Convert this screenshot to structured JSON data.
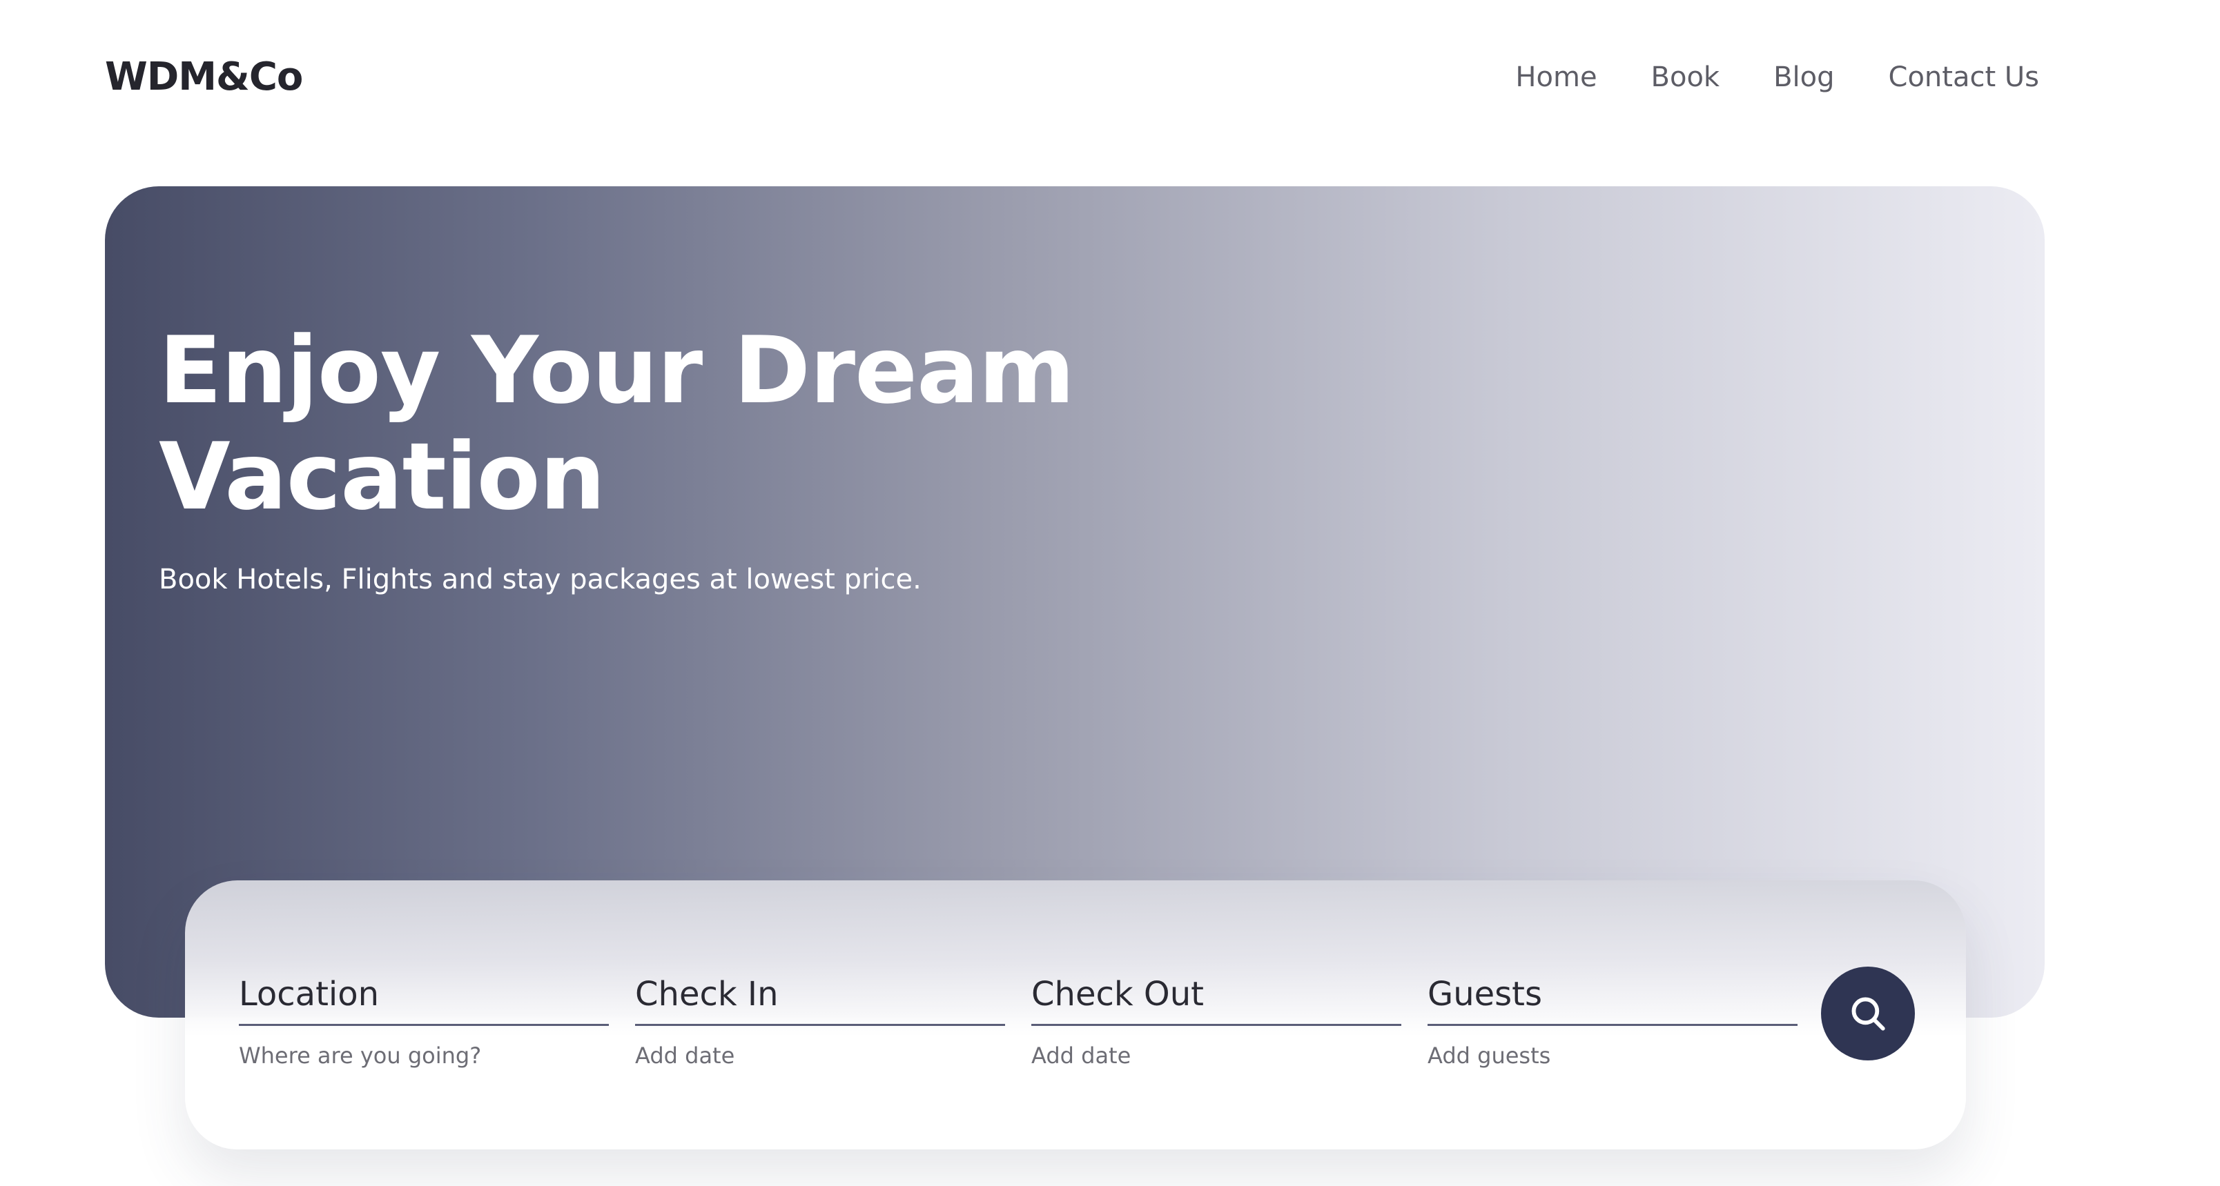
{
  "brand": {
    "logo": "WDM&Co"
  },
  "nav": {
    "items": [
      "Home",
      "Book",
      "Blog",
      "Contact Us"
    ]
  },
  "hero": {
    "title_line1": "Enjoy Your Dream",
    "title_line2": "Vacation",
    "subtitle": "Book Hotels, Flights and stay packages at lowest price."
  },
  "search": {
    "fields": [
      {
        "label": "Location",
        "placeholder": "Where are you going?"
      },
      {
        "label": "Check In",
        "placeholder": "Add date"
      },
      {
        "label": "Check Out",
        "placeholder": "Add date"
      },
      {
        "label": "Guests",
        "placeholder": "Add guests"
      }
    ],
    "button_icon": "search-icon"
  },
  "colors": {
    "accent": "#2f3553",
    "hero_start": "#474c66",
    "hero_end": "#ececf3",
    "text_dark": "#25252d",
    "text_muted": "#6d6d75"
  }
}
